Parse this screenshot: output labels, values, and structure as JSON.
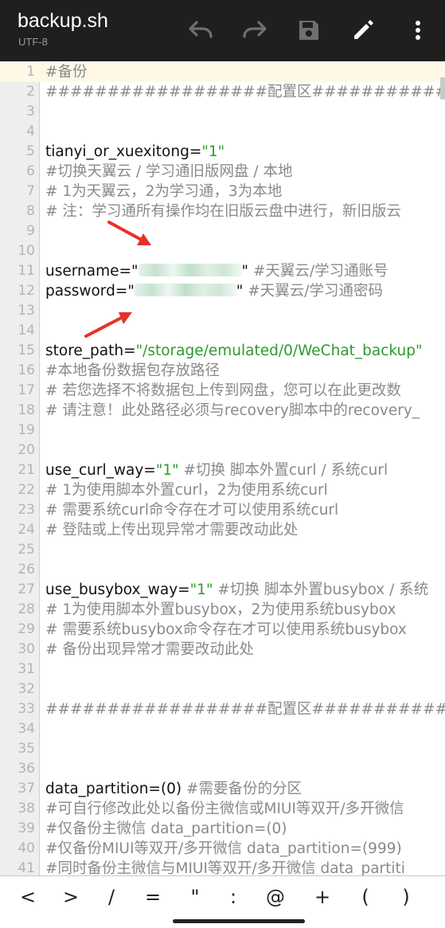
{
  "toolbar": {
    "title": "backup.sh",
    "encoding": "UTF-8",
    "icons": [
      "undo-icon",
      "redo-icon",
      "save-icon",
      "edit-icon",
      "more-icon"
    ]
  },
  "editor": {
    "lines": [
      {
        "n": "1",
        "segs": [
          {
            "t": "#备份",
            "c": "cmt"
          }
        ]
      },
      {
        "n": "2",
        "segs": [
          {
            "t": "##################配置区##################",
            "c": "cmt"
          }
        ]
      },
      {
        "n": "3",
        "segs": []
      },
      {
        "n": "4",
        "segs": []
      },
      {
        "n": "5",
        "segs": [
          {
            "t": "tianyi_or_xuexitong=",
            "c": "key"
          },
          {
            "t": "\"1\"",
            "c": "str"
          }
        ]
      },
      {
        "n": "6",
        "segs": [
          {
            "t": "#切换天翼云 / 学习通旧版网盘 / 本地",
            "c": "cmt"
          }
        ]
      },
      {
        "n": "7",
        "segs": [
          {
            "t": "# 1为天翼云，2为学习通，3为本地",
            "c": "cmt"
          }
        ]
      },
      {
        "n": "8",
        "segs": [
          {
            "t": "# 注：学习通所有操作均在旧版云盘中进行，新旧版云",
            "c": "cmt"
          }
        ]
      },
      {
        "n": "9",
        "segs": []
      },
      {
        "n": "10",
        "segs": []
      },
      {
        "n": "11",
        "segs": [
          {
            "t": "username=\"",
            "c": "key"
          },
          {
            "blur": true
          },
          {
            "t": "\"",
            "c": "key"
          },
          {
            "t": " #天翼云/学习通账号",
            "c": "cmt"
          }
        ]
      },
      {
        "n": "12",
        "segs": [
          {
            "t": "password=\"",
            "c": "key"
          },
          {
            "blur": true
          },
          {
            "t": "\"",
            "c": "key"
          },
          {
            "t": " #天翼云/学习通密码",
            "c": "cmt"
          }
        ]
      },
      {
        "n": "13",
        "segs": []
      },
      {
        "n": "14",
        "segs": []
      },
      {
        "n": "15",
        "segs": [
          {
            "t": "store_path=",
            "c": "key"
          },
          {
            "t": "\"/storage/emulated/0/WeChat_backup\"",
            "c": "str"
          }
        ]
      },
      {
        "n": "16",
        "segs": [
          {
            "t": "#本地备份数据包存放路径",
            "c": "cmt"
          }
        ]
      },
      {
        "n": "17",
        "segs": [
          {
            "t": "# 若您选择不将数据包上传到网盘，您可以在此更改数",
            "c": "cmt"
          }
        ]
      },
      {
        "n": "18",
        "segs": [
          {
            "t": "# 请注意！此处路径必须与recovery脚本中的recovery_",
            "c": "cmt"
          }
        ]
      },
      {
        "n": "19",
        "segs": []
      },
      {
        "n": "20",
        "segs": []
      },
      {
        "n": "21",
        "segs": [
          {
            "t": "use_curl_way=",
            "c": "key"
          },
          {
            "t": "\"1\"",
            "c": "str"
          },
          {
            "t": " #切换 脚本外置curl / 系统curl",
            "c": "cmt"
          }
        ]
      },
      {
        "n": "22",
        "segs": [
          {
            "t": "# 1为使用脚本外置curl，2为使用系统curl",
            "c": "cmt"
          }
        ]
      },
      {
        "n": "23",
        "segs": [
          {
            "t": "# 需要系统curl命令存在才可以使用系统curl",
            "c": "cmt"
          }
        ]
      },
      {
        "n": "24",
        "segs": [
          {
            "t": "# 登陆或上传出现异常才需要改动此处",
            "c": "cmt"
          }
        ]
      },
      {
        "n": "25",
        "segs": []
      },
      {
        "n": "26",
        "segs": []
      },
      {
        "n": "27",
        "segs": [
          {
            "t": "use_busybox_way=",
            "c": "key"
          },
          {
            "t": "\"1\"",
            "c": "str"
          },
          {
            "t": " #切换 脚本外置busybox / 系统",
            "c": "cmt"
          }
        ]
      },
      {
        "n": "28",
        "segs": [
          {
            "t": "# 1为使用脚本外置busybox，2为使用系统busybox",
            "c": "cmt"
          }
        ]
      },
      {
        "n": "29",
        "segs": [
          {
            "t": "# 需要系统busybox命令存在才可以使用系统busybox",
            "c": "cmt"
          }
        ]
      },
      {
        "n": "30",
        "segs": [
          {
            "t": "# 备份出现异常才需要改动此处",
            "c": "cmt"
          }
        ]
      },
      {
        "n": "31",
        "segs": []
      },
      {
        "n": "32",
        "segs": []
      },
      {
        "n": "33",
        "segs": [
          {
            "t": "##################配置区##################",
            "c": "cmt"
          }
        ]
      },
      {
        "n": "34",
        "segs": []
      },
      {
        "n": "35",
        "segs": []
      },
      {
        "n": "36",
        "segs": []
      },
      {
        "n": "37",
        "segs": [
          {
            "t": "data_partition=(0)",
            "c": "key"
          },
          {
            "t": " #需要备份的分区",
            "c": "cmt"
          }
        ]
      },
      {
        "n": "38",
        "segs": [
          {
            "t": "#可自行修改此处以备份主微信或MIUI等双开/多开微信",
            "c": "cmt"
          }
        ]
      },
      {
        "n": "39",
        "segs": [
          {
            "t": "#仅备份主微信   data_partition=(0)",
            "c": "cmt"
          }
        ]
      },
      {
        "n": "40",
        "segs": [
          {
            "t": "#仅备份MIUI等双开/多开微信   data_partition=(999)",
            "c": "cmt"
          }
        ]
      },
      {
        "n": "41",
        "segs": [
          {
            "t": "#同时备份主微信与MIUI等双开/多开微信   data_partiti",
            "c": "cmt"
          }
        ]
      }
    ]
  },
  "symbols": [
    "<",
    ">",
    "/",
    "=",
    "\"",
    ":",
    "@",
    "+",
    "(",
    ")"
  ]
}
